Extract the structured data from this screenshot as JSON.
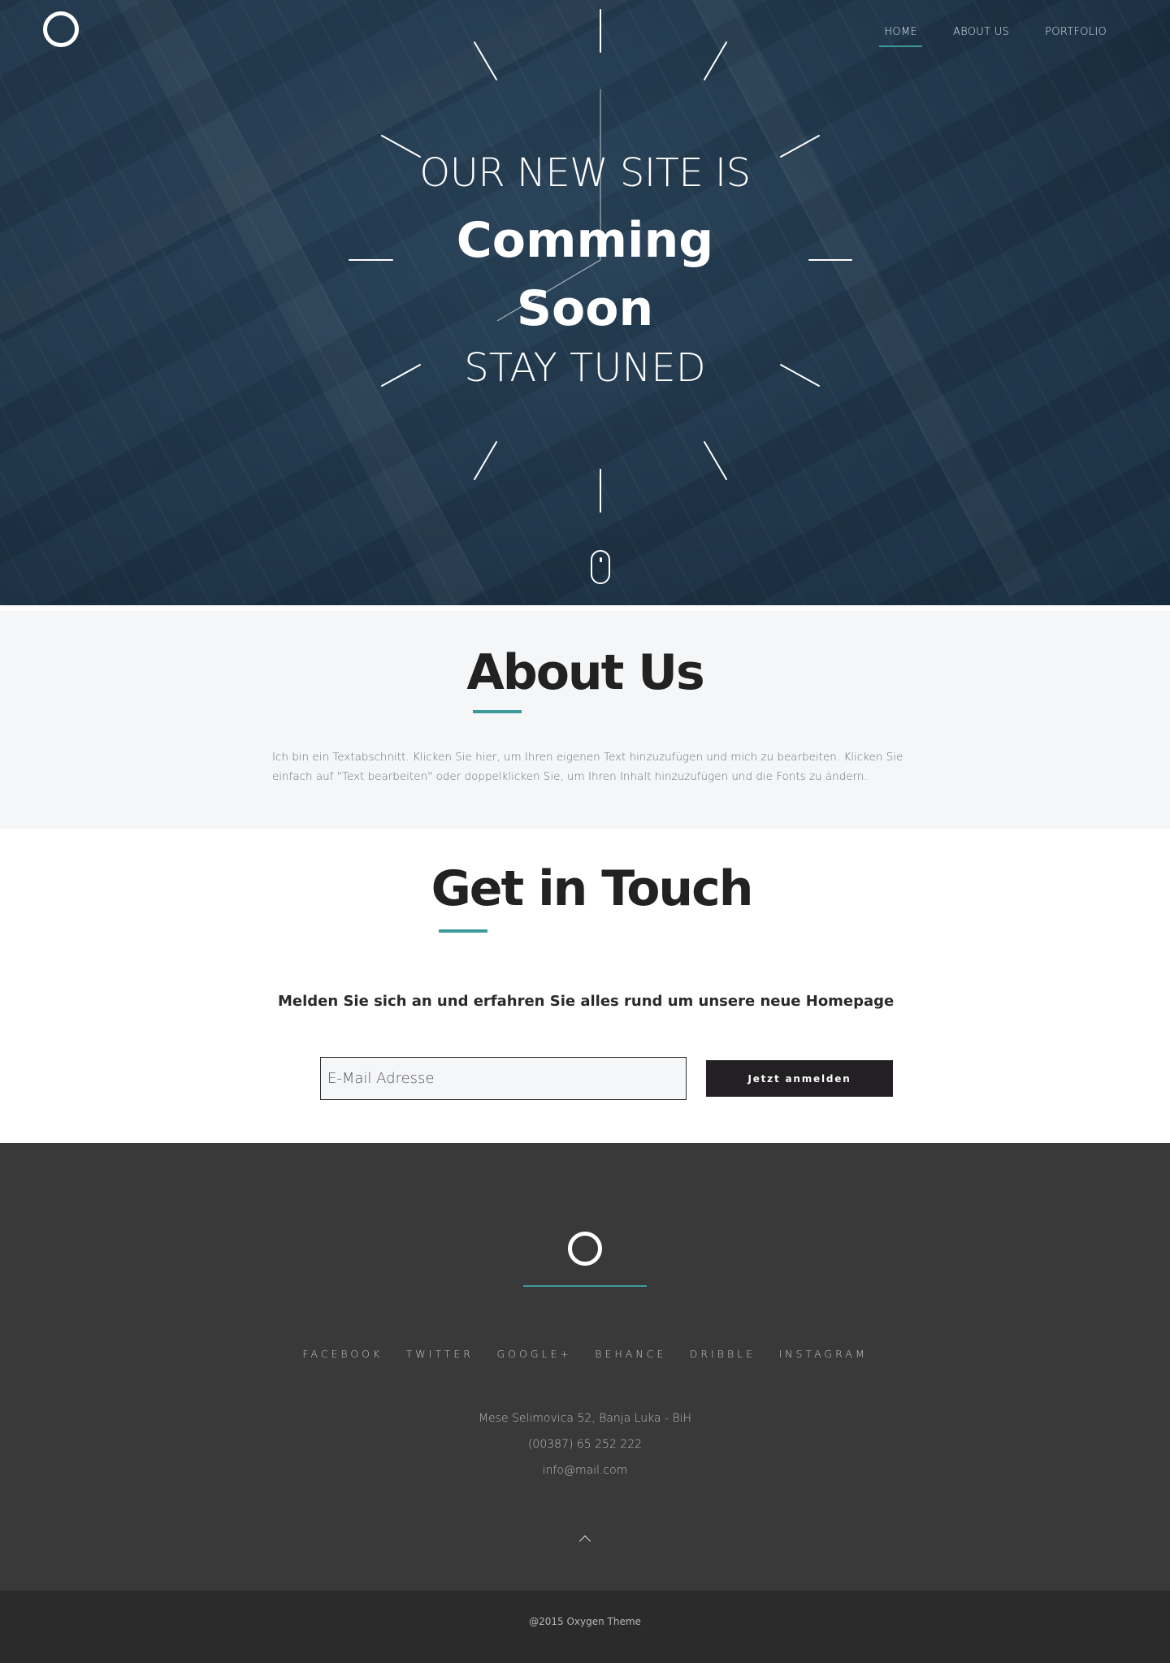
{
  "nav": {
    "items": [
      {
        "label": "HOME",
        "active": true
      },
      {
        "label": "ABOUT US",
        "active": false
      },
      {
        "label": "PORTFOLIO",
        "active": false
      }
    ]
  },
  "hero": {
    "line1": "OUR NEW SITE IS",
    "line2": "Comming",
    "line3": "Soon",
    "line4": "STAY TUNED",
    "background_color": "#223a4f"
  },
  "about": {
    "title": "About Us",
    "text": "Ich bin ein Textabschnitt. Klicken Sie hier, um Ihren eigenen Text hinzuzufügen und mich zu bearbeiten. Klicken Sie einfach auf \"Text bearbeiten\" oder doppelklicken Sie, um Ihren Inhalt hinzuzufügen und die Fonts zu ändern."
  },
  "contact": {
    "title": "Get in Touch",
    "subtitle": "Melden Sie sich an und erfahren Sie alles rund um unsere neue Homepage",
    "email_placeholder": "E-Mail Adresse",
    "button_label": "Jetzt anmelden"
  },
  "footer": {
    "social": [
      "FACEBOOK",
      "TWITTER",
      "GOOGLE+",
      "BEHANCE",
      "DRIBBLE",
      "INSTAGRAM"
    ],
    "address": "Mese Selimovica 52, Banja Luka - BiH",
    "phone": "(00387) 65 252 222",
    "email": "info@mail.com",
    "copyright": "@2015 Oxygen Theme"
  },
  "colors": {
    "accent": "#3f9a9a",
    "dark_button": "#222022",
    "footer_bg": "#383938",
    "bottom_bar_bg": "#2a2b2a"
  }
}
